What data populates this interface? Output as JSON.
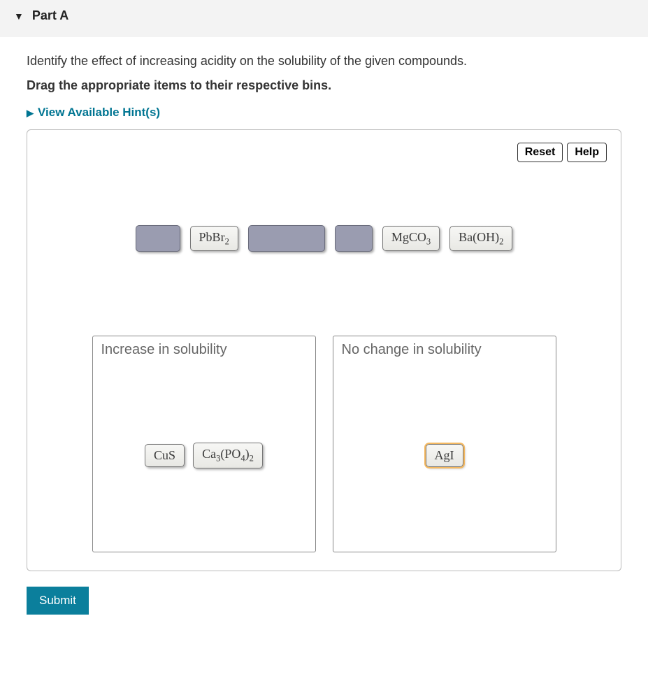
{
  "part": {
    "label": "Part A"
  },
  "question": {
    "prompt": "Identify the effect of increasing acidity on the solubility of the given compounds.",
    "instruction": "Drag the appropriate items to their respective bins.",
    "hints_link": "View Available Hint(s)"
  },
  "toolbar": {
    "reset": "Reset",
    "help": "Help"
  },
  "source_items": {
    "pbbr2": "PbBr",
    "pbbr2_sub": "2",
    "mgco3": "MgCO",
    "mgco3_sub": "3",
    "baoh2_pre": "Ba(OH)",
    "baoh2_sub": "2"
  },
  "bins": {
    "increase": {
      "label": "Increase in solubility"
    },
    "nochange": {
      "label": "No change in solubility"
    }
  },
  "bin_items": {
    "cus": "CuS",
    "ca3po4_a": "Ca",
    "ca3po4_sub1": "3",
    "ca3po4_b": "(PO",
    "ca3po4_sub2": "4",
    "ca3po4_c": ")",
    "ca3po4_sub3": "2",
    "agi": "AgI"
  },
  "actions": {
    "submit": "Submit"
  }
}
